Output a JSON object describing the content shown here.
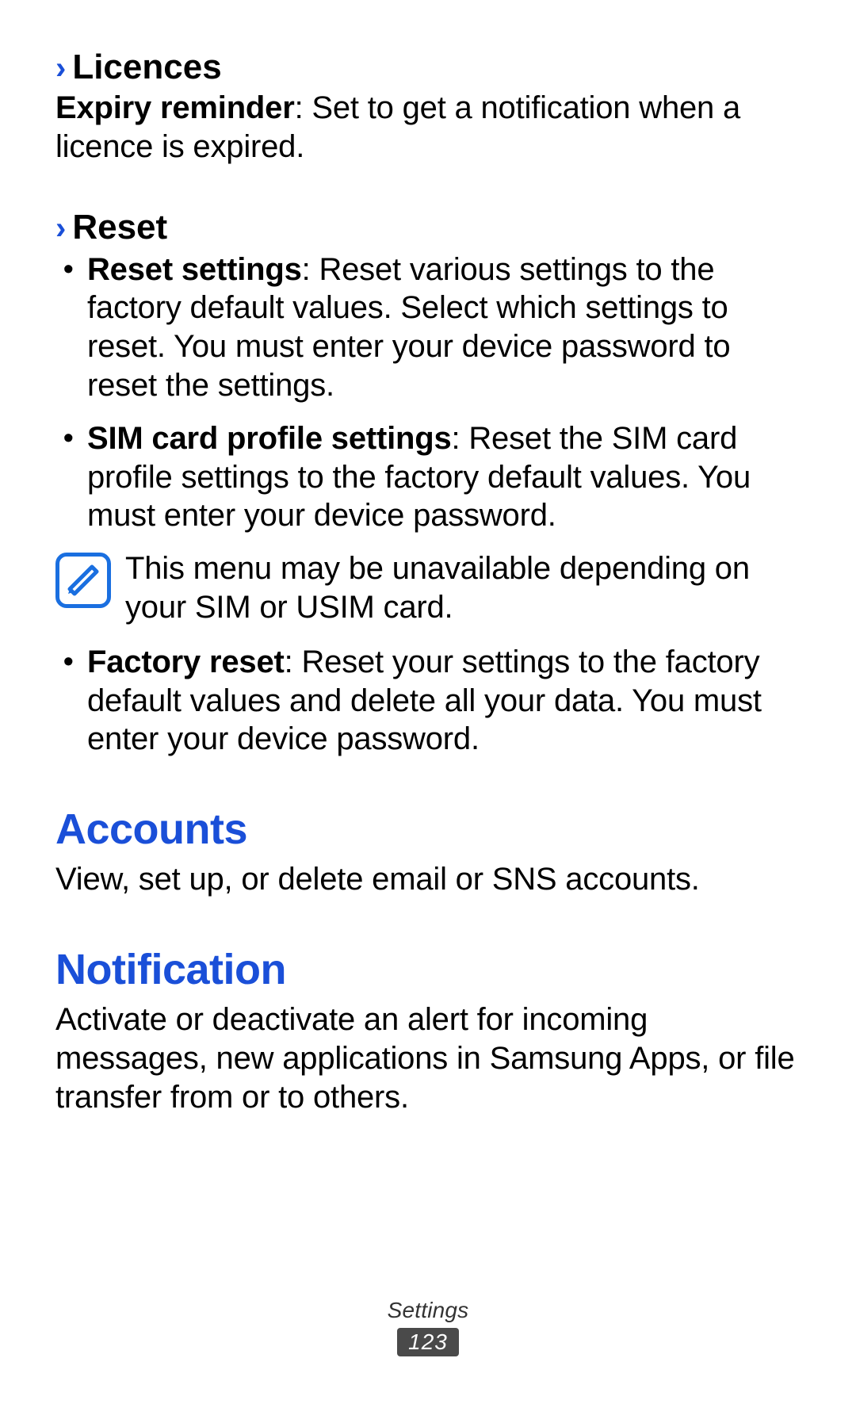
{
  "sections": {
    "licences": {
      "heading": "Licences",
      "expiry_bold": "Expiry reminder",
      "expiry_rest": ": Set to get a notification when a licence is expired."
    },
    "reset": {
      "heading": "Reset",
      "items": [
        {
          "bold": "Reset settings",
          "rest": ": Reset various settings to the factory default values. Select which settings to reset. You must enter your device password to reset the settings."
        },
        {
          "bold": "SIM card profile settings",
          "rest": ": Reset the SIM card profile settings to the factory default values. You must enter your device password."
        }
      ],
      "note": "This menu may be unavailable depending on your SIM or USIM card.",
      "items2": [
        {
          "bold": "Factory reset",
          "rest": ": Reset your settings to the factory default values and delete all your data. You must enter your device password."
        }
      ]
    },
    "accounts": {
      "heading": "Accounts",
      "body": "View, set up, or delete email or SNS accounts."
    },
    "notification": {
      "heading": "Notification",
      "body": "Activate or deactivate an alert for incoming messages, new applications in Samsung Apps, or file transfer from or to others."
    }
  },
  "footer": {
    "section": "Settings",
    "page": "123"
  }
}
